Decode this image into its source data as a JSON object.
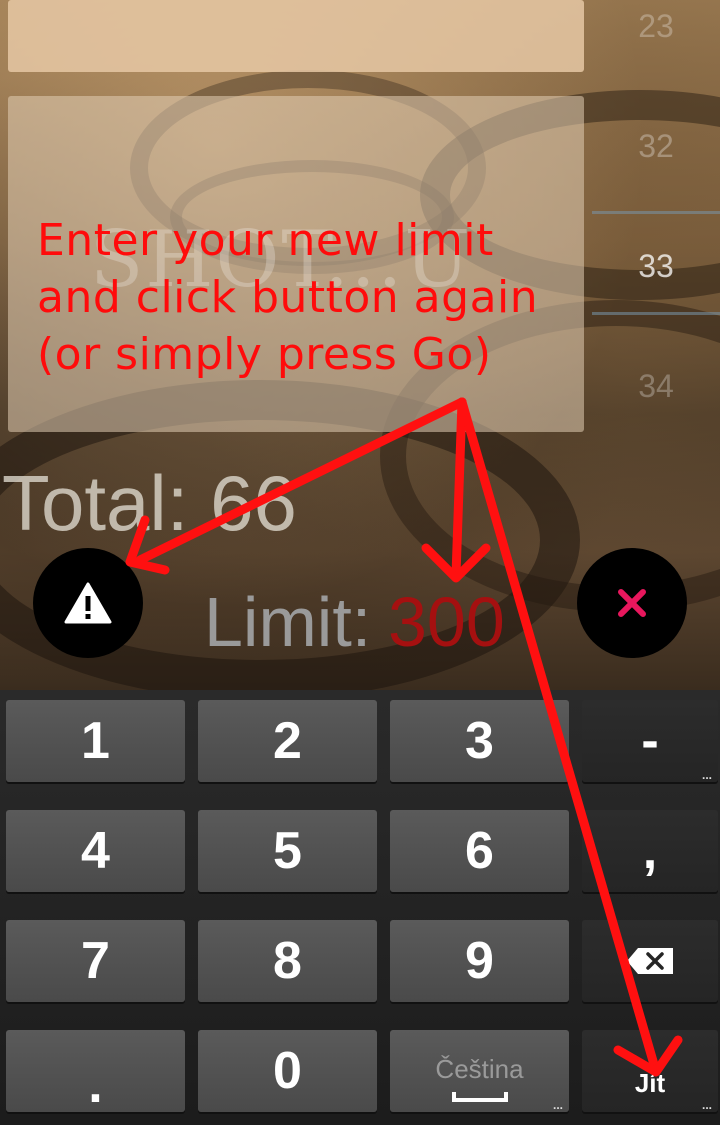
{
  "hint": {
    "lines": [
      "Enter your new limit",
      "and click button again",
      "(or simply press Go)"
    ],
    "color": "#ff0b0b"
  },
  "background_text": "SHOT...U",
  "picker": {
    "items": [
      "23",
      "32",
      "33",
      "34"
    ],
    "selected": "33"
  },
  "total": {
    "label": "Total:",
    "value": "66"
  },
  "limit": {
    "label": "Limit:",
    "value": "300",
    "value_color": "#a51010"
  },
  "buttons": {
    "warning": {
      "icon": "warning-icon"
    },
    "close": {
      "icon": "close-icon",
      "color": "#e8175d"
    }
  },
  "keyboard": {
    "rows": [
      [
        "1",
        "2",
        "3",
        "-"
      ],
      [
        "4",
        "5",
        "6",
        ","
      ],
      [
        "7",
        "8",
        "9",
        "backspace"
      ],
      [
        ".",
        "0",
        "Čeština",
        "Jít"
      ]
    ],
    "language": "Čeština",
    "go_label": "Jít",
    "more_dots": "..."
  }
}
